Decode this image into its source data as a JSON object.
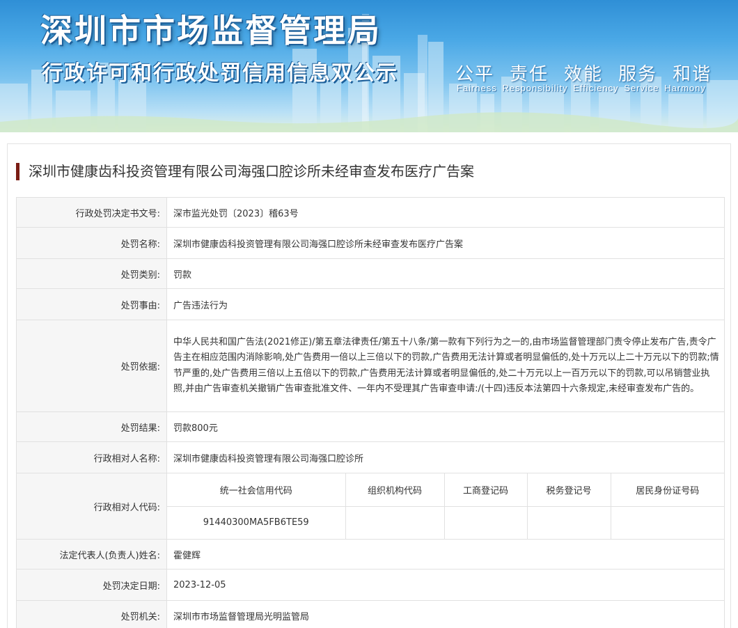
{
  "banner": {
    "title": "深圳市市场监督管理局",
    "subtitle": "行政许可和行政处罚信用信息双公示",
    "slogan": [
      "公平",
      "责任",
      "效能",
      "服务",
      "和谐"
    ],
    "slogan_en": "Fairness Responsibility Efficiency Service Harmony"
  },
  "case_title": "深圳市健康齿科投资管理有限公司海强口腔诊所未经审查发布医疗广告案",
  "rows": {
    "decision_no": {
      "label": "行政处罚决定书文号:",
      "value": "深市监光处罚〔2023〕稽63号"
    },
    "penalty_name": {
      "label": "处罚名称:",
      "value": "深圳市健康齿科投资管理有限公司海强口腔诊所未经审查发布医疗广告案"
    },
    "penalty_type": {
      "label": "处罚类别:",
      "value": "罚款"
    },
    "penalty_reason": {
      "label": "处罚事由:",
      "value": "广告违法行为"
    },
    "penalty_basis": {
      "label": "处罚依据:",
      "value": "中华人民共和国广告法(2021修正)/第五章法律责任/第五十八条/第一款有下列行为之一的,由市场监督管理部门责令停止发布广告,责令广告主在相应范围内消除影响,处广告费用一倍以上三倍以下的罚款,广告费用无法计算或者明显偏低的,处十万元以上二十万元以下的罚款;情节严重的,处广告费用三倍以上五倍以下的罚款,广告费用无法计算或者明显偏低的,处二十万元以上一百万元以下的罚款,可以吊销营业执照,并由广告审查机关撤销广告审查批准文件、一年内不受理其广告审查申请:/(十四)违反本法第四十六条规定,未经审查发布广告的。"
    },
    "penalty_result": {
      "label": "处罚结果:",
      "value": "罚款800元"
    },
    "party_name": {
      "label": "行政相对人名称:",
      "value": "深圳市健康齿科投资管理有限公司海强口腔诊所"
    },
    "party_code": {
      "label": "行政相对人代码:",
      "headers": [
        "统一社会信用代码",
        "组织机构代码",
        "工商登记码",
        "税务登记号",
        "居民身份证号码"
      ],
      "values": [
        "91440300MA5FB6TE59",
        "",
        "",
        "",
        ""
      ]
    },
    "legal_rep": {
      "label": "法定代表人(负责人)姓名:",
      "value": "霍健辉"
    },
    "decision_date": {
      "label": "处罚决定日期:",
      "value": "2023-12-05"
    },
    "authority": {
      "label": "处罚机关:",
      "value": "深圳市市场监督管理局光明监管局"
    }
  },
  "colors": {
    "accent_bar": "#7a1d14",
    "banner_blue": "#2f8fd6",
    "label_bg": "#f6f6f6",
    "border": "#e1e1e1"
  }
}
